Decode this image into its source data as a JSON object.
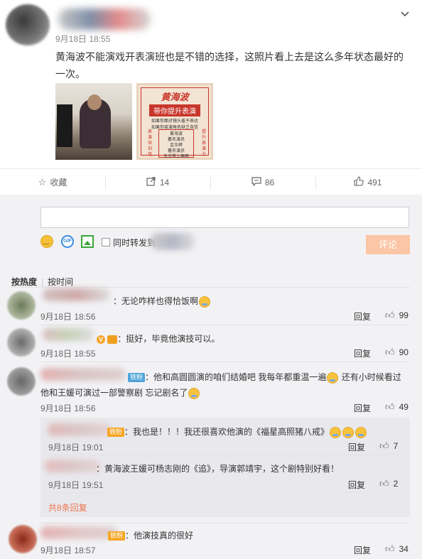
{
  "post": {
    "time": "9月18日 18:55",
    "text": "黄海波不能演戏开表演班也是不错的选择，这照片看上去是这么多年状态最好的一次。",
    "poster_title": "黄海波",
    "poster_subtitle": "带你提升表演",
    "poster_line1": "如果你面对镜头羞于表达",
    "poster_line2": "如果你接演角色缺乏自信",
    "poster_box": [
      "黄海波",
      "著名演员",
      "金玉婷",
      "著名演员",
      "五次登上春晚"
    ],
    "poster_left": [
      "表",
      "演",
      "培",
      "训",
      "班"
    ],
    "poster_right": [
      "提",
      "升",
      "表",
      "演",
      "力"
    ]
  },
  "actions": {
    "favorite_label": "收藏",
    "repost_count": "14",
    "comment_count": "86",
    "like_count": "491"
  },
  "composer": {
    "repost_label": "同时转发到",
    "submit_label": "评论"
  },
  "sort": {
    "hot": "按热度",
    "time": "按时间"
  },
  "comments": [
    {
      "text": "：无论咋样也得恰饭啊",
      "time": "9月18日 18:56",
      "reply": "回复",
      "likes": "99"
    },
    {
      "text": "：挺好，毕竟他演技可以。",
      "time": "9月18日 18:55",
      "reply": "回复",
      "likes": "90"
    },
    {
      "badge": "铁粉",
      "text1": "：他和高圆圆演的咱们结婚吧 我每年都重温一遍",
      "text2": "还有小时候看过",
      "text3": "他和王媛可演过一部警察剧 忘记剧名了",
      "time": "9月18日 18:56",
      "reply": "回复",
      "likes": "49"
    },
    {
      "badge": "铁粉",
      "text": "：我也是！！！我还很喜欢他演的《福星高照猪八戒》",
      "time": "9月18日 19:01",
      "reply": "回复",
      "likes": "7"
    },
    {
      "text": "：黄海波王媛可杨志刚的《追》，导演郭靖宇，这个剧特别好看！",
      "time": "9月18日 19:51",
      "reply": "回复",
      "likes": "2"
    },
    {
      "badge": "铁粉",
      "text": "：他演技真的很好",
      "time": "9月18日 18:57",
      "reply": "回复",
      "likes": "34"
    }
  ],
  "more_replies": "共8条回复",
  "colors": {
    "accent": "#eb7350",
    "submit_bg": "#fcc5a5",
    "bg_gray": "#f2f2f5"
  }
}
